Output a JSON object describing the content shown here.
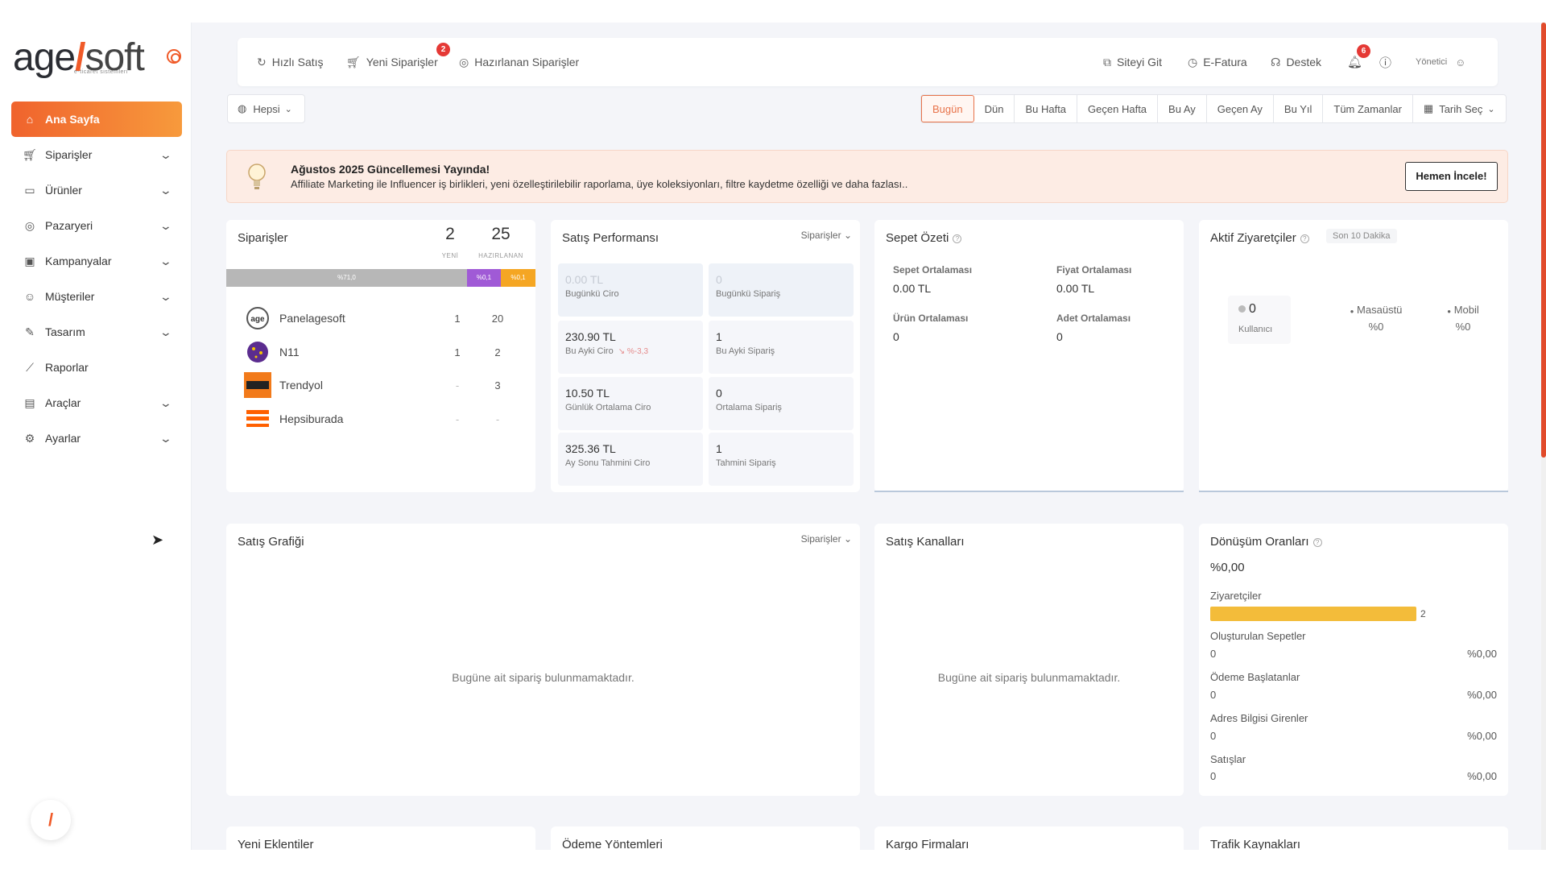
{
  "brand": {
    "logo_main": "age",
    "logo_slash": "/",
    "logo_tail": "soft",
    "logo_sub": "e-ticaret sistemleri",
    "accent": "#f05a28"
  },
  "sidebar": {
    "items": [
      {
        "label": "Ana Sayfa",
        "icon": "home-icon",
        "active": true,
        "has_children": false
      },
      {
        "label": "Siparişler",
        "icon": "cart-icon",
        "has_children": true
      },
      {
        "label": "Ürünler",
        "icon": "book-icon",
        "has_children": true
      },
      {
        "label": "Pazaryeri",
        "icon": "globe-icon",
        "has_children": true
      },
      {
        "label": "Kampanyalar",
        "icon": "gift-icon",
        "has_children": true
      },
      {
        "label": "Müşteriler",
        "icon": "user-icon",
        "has_children": true
      },
      {
        "label": "Tasarım",
        "icon": "edit-icon",
        "has_children": true
      },
      {
        "label": "Raporlar",
        "icon": "chart-line-icon",
        "has_children": false
      },
      {
        "label": "Araçlar",
        "icon": "calendar-icon",
        "has_children": true
      },
      {
        "label": "Ayarlar",
        "icon": "gear-icon",
        "has_children": true
      }
    ]
  },
  "topbar": {
    "left": [
      {
        "label": "Hızlı Satış",
        "icon": "refresh-icon"
      },
      {
        "label": "Yeni Siparişler",
        "icon": "cart-icon",
        "badge": "2"
      },
      {
        "label": "Hazırlanan Siparişler",
        "icon": "box-icon"
      }
    ],
    "right": [
      {
        "label": "Siteyi Git",
        "icon": "external-link-icon"
      },
      {
        "label": "E-Fatura",
        "icon": "receipt-icon"
      },
      {
        "label": "Destek",
        "icon": "headset-icon"
      }
    ],
    "notif_badge": "6",
    "user_label": "Yönetici"
  },
  "filters": {
    "scope": "Hepsi",
    "ranges": [
      "Bugün",
      "Dün",
      "Bu Hafta",
      "Geçen Hafta",
      "Bu Ay",
      "Geçen Ay",
      "Bu Yıl",
      "Tüm Zamanlar"
    ],
    "active_range": "Bugün",
    "date_pick": "Tarih Seç"
  },
  "banner": {
    "title": "Ağustos 2025 Güncellemesi Yayında!",
    "text": "Affiliate Marketing ile Influencer iş birlikleri, yeni özelleştirilebilir raporlama, üye koleksiyonları, filtre kaydetme özelliği ve daha fazlası..",
    "button": "Hemen İncele!"
  },
  "orders": {
    "title": "Siparişler",
    "new_count": "2",
    "new_label": "YENİ",
    "prep_count": "25",
    "prep_label": "HAZIRLANAN",
    "bar": [
      {
        "label": "%71,0",
        "pct": 71,
        "color": "#b0b0b0"
      },
      {
        "label": "%0,1",
        "pct": 10,
        "color": "#a05ad6"
      },
      {
        "label": "%0,1",
        "pct": 10,
        "color": "#f5a623"
      }
    ],
    "sources": [
      {
        "name": "Panelagesoft",
        "a": "1",
        "b": "20"
      },
      {
        "name": "N11",
        "a": "1",
        "b": "2"
      },
      {
        "name": "Trendyol",
        "a": "-",
        "b": "3"
      },
      {
        "name": "Hepsiburada",
        "a": "-",
        "b": "-"
      }
    ]
  },
  "performance": {
    "title": "Satış Performansı",
    "dropdown": "Siparişler",
    "tiles": [
      {
        "value": "0.00 TL",
        "label": "Bugünkü Ciro"
      },
      {
        "value": "0",
        "label": "Bugünkü Sipariş"
      },
      {
        "value": "230.90 TL",
        "label": "Bu Ayki Ciro",
        "change": "%-3,3"
      },
      {
        "value": "1",
        "label": "Bu Ayki Sipariş"
      },
      {
        "value": "10.50 TL",
        "label": "Günlük Ortalama Ciro"
      },
      {
        "value": "0",
        "label": "Ortalama Sipariş"
      },
      {
        "value": "325.36 TL",
        "label": "Ay Sonu Tahmini Ciro"
      },
      {
        "value": "1",
        "label": "Tahmini Sipariş"
      }
    ]
  },
  "basket": {
    "title": "Sepet Özeti",
    "items": [
      {
        "label": "Sepet Ortalaması",
        "value": "0.00 TL"
      },
      {
        "label": "Fiyat Ortalaması",
        "value": "0.00 TL"
      },
      {
        "label": "Ürün Ortalaması",
        "value": "0"
      },
      {
        "label": "Adet Ortalaması",
        "value": "0"
      }
    ]
  },
  "visitors": {
    "title": "Aktif Ziyaretçiler",
    "chip": "Son 10 Dakika",
    "count": "0",
    "count_label": "Kullanıcı",
    "desktop_label": "Masaüstü",
    "desktop_value": "%0",
    "mobile_label": "Mobil",
    "mobile_value": "%0"
  },
  "sales_chart": {
    "title": "Satış Grafiği",
    "dropdown": "Siparişler",
    "empty": "Bugüne ait sipariş bulunmamaktadır."
  },
  "channels": {
    "title": "Satış Kanalları",
    "empty": "Bugüne ait sipariş bulunmamaktadır."
  },
  "conversion": {
    "title": "Dönüşüm Oranları",
    "total": "%0,00",
    "visitors_label": "Ziyaretçiler",
    "visitors_value": "2",
    "rows": [
      {
        "label": "Oluşturulan Sepetler",
        "value": "0",
        "pct": "%0,00"
      },
      {
        "label": "Ödeme Başlatanlar",
        "value": "0",
        "pct": "%0,00"
      },
      {
        "label": "Adres Bilgisi Girenler",
        "value": "0",
        "pct": "%0,00"
      },
      {
        "label": "Satışlar",
        "value": "0",
        "pct": "%0,00"
      }
    ]
  },
  "bottom_cards": [
    "Yeni Eklentiler",
    "Ödeme Yöntemleri",
    "Kargo Firmaları",
    "Trafik Kaynakları"
  ]
}
